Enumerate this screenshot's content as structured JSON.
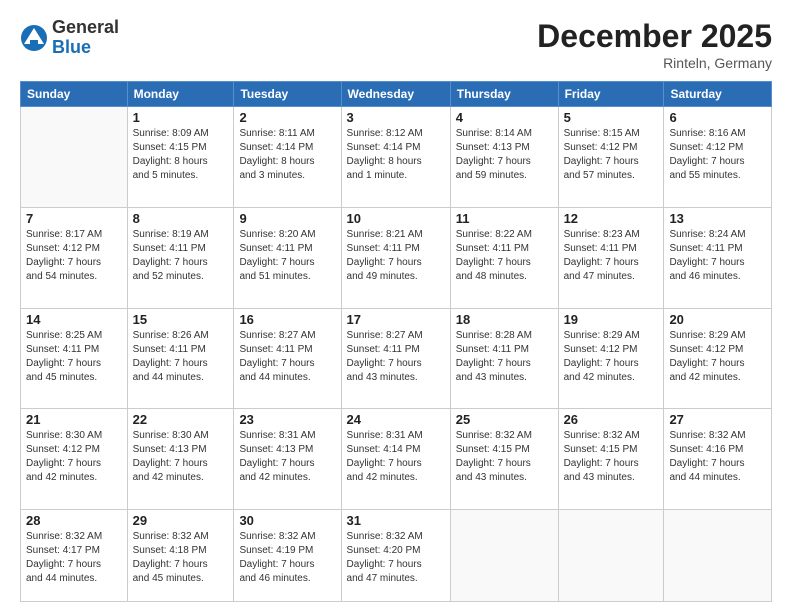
{
  "logo": {
    "general": "General",
    "blue": "Blue"
  },
  "title": "December 2025",
  "location": "Rinteln, Germany",
  "days_of_week": [
    "Sunday",
    "Monday",
    "Tuesday",
    "Wednesday",
    "Thursday",
    "Friday",
    "Saturday"
  ],
  "weeks": [
    [
      {
        "day": "",
        "info": ""
      },
      {
        "day": "1",
        "info": "Sunrise: 8:09 AM\nSunset: 4:15 PM\nDaylight: 8 hours\nand 5 minutes."
      },
      {
        "day": "2",
        "info": "Sunrise: 8:11 AM\nSunset: 4:14 PM\nDaylight: 8 hours\nand 3 minutes."
      },
      {
        "day": "3",
        "info": "Sunrise: 8:12 AM\nSunset: 4:14 PM\nDaylight: 8 hours\nand 1 minute."
      },
      {
        "day": "4",
        "info": "Sunrise: 8:14 AM\nSunset: 4:13 PM\nDaylight: 7 hours\nand 59 minutes."
      },
      {
        "day": "5",
        "info": "Sunrise: 8:15 AM\nSunset: 4:12 PM\nDaylight: 7 hours\nand 57 minutes."
      },
      {
        "day": "6",
        "info": "Sunrise: 8:16 AM\nSunset: 4:12 PM\nDaylight: 7 hours\nand 55 minutes."
      }
    ],
    [
      {
        "day": "7",
        "info": "Sunrise: 8:17 AM\nSunset: 4:12 PM\nDaylight: 7 hours\nand 54 minutes."
      },
      {
        "day": "8",
        "info": "Sunrise: 8:19 AM\nSunset: 4:11 PM\nDaylight: 7 hours\nand 52 minutes."
      },
      {
        "day": "9",
        "info": "Sunrise: 8:20 AM\nSunset: 4:11 PM\nDaylight: 7 hours\nand 51 minutes."
      },
      {
        "day": "10",
        "info": "Sunrise: 8:21 AM\nSunset: 4:11 PM\nDaylight: 7 hours\nand 49 minutes."
      },
      {
        "day": "11",
        "info": "Sunrise: 8:22 AM\nSunset: 4:11 PM\nDaylight: 7 hours\nand 48 minutes."
      },
      {
        "day": "12",
        "info": "Sunrise: 8:23 AM\nSunset: 4:11 PM\nDaylight: 7 hours\nand 47 minutes."
      },
      {
        "day": "13",
        "info": "Sunrise: 8:24 AM\nSunset: 4:11 PM\nDaylight: 7 hours\nand 46 minutes."
      }
    ],
    [
      {
        "day": "14",
        "info": "Sunrise: 8:25 AM\nSunset: 4:11 PM\nDaylight: 7 hours\nand 45 minutes."
      },
      {
        "day": "15",
        "info": "Sunrise: 8:26 AM\nSunset: 4:11 PM\nDaylight: 7 hours\nand 44 minutes."
      },
      {
        "day": "16",
        "info": "Sunrise: 8:27 AM\nSunset: 4:11 PM\nDaylight: 7 hours\nand 44 minutes."
      },
      {
        "day": "17",
        "info": "Sunrise: 8:27 AM\nSunset: 4:11 PM\nDaylight: 7 hours\nand 43 minutes."
      },
      {
        "day": "18",
        "info": "Sunrise: 8:28 AM\nSunset: 4:11 PM\nDaylight: 7 hours\nand 43 minutes."
      },
      {
        "day": "19",
        "info": "Sunrise: 8:29 AM\nSunset: 4:12 PM\nDaylight: 7 hours\nand 42 minutes."
      },
      {
        "day": "20",
        "info": "Sunrise: 8:29 AM\nSunset: 4:12 PM\nDaylight: 7 hours\nand 42 minutes."
      }
    ],
    [
      {
        "day": "21",
        "info": "Sunrise: 8:30 AM\nSunset: 4:12 PM\nDaylight: 7 hours\nand 42 minutes."
      },
      {
        "day": "22",
        "info": "Sunrise: 8:30 AM\nSunset: 4:13 PM\nDaylight: 7 hours\nand 42 minutes."
      },
      {
        "day": "23",
        "info": "Sunrise: 8:31 AM\nSunset: 4:13 PM\nDaylight: 7 hours\nand 42 minutes."
      },
      {
        "day": "24",
        "info": "Sunrise: 8:31 AM\nSunset: 4:14 PM\nDaylight: 7 hours\nand 42 minutes."
      },
      {
        "day": "25",
        "info": "Sunrise: 8:32 AM\nSunset: 4:15 PM\nDaylight: 7 hours\nand 43 minutes."
      },
      {
        "day": "26",
        "info": "Sunrise: 8:32 AM\nSunset: 4:15 PM\nDaylight: 7 hours\nand 43 minutes."
      },
      {
        "day": "27",
        "info": "Sunrise: 8:32 AM\nSunset: 4:16 PM\nDaylight: 7 hours\nand 44 minutes."
      }
    ],
    [
      {
        "day": "28",
        "info": "Sunrise: 8:32 AM\nSunset: 4:17 PM\nDaylight: 7 hours\nand 44 minutes."
      },
      {
        "day": "29",
        "info": "Sunrise: 8:32 AM\nSunset: 4:18 PM\nDaylight: 7 hours\nand 45 minutes."
      },
      {
        "day": "30",
        "info": "Sunrise: 8:32 AM\nSunset: 4:19 PM\nDaylight: 7 hours\nand 46 minutes."
      },
      {
        "day": "31",
        "info": "Sunrise: 8:32 AM\nSunset: 4:20 PM\nDaylight: 7 hours\nand 47 minutes."
      },
      {
        "day": "",
        "info": ""
      },
      {
        "day": "",
        "info": ""
      },
      {
        "day": "",
        "info": ""
      }
    ]
  ]
}
